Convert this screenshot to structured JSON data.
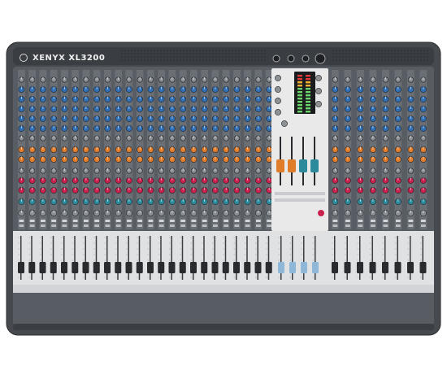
{
  "product": {
    "brand": "XENYX",
    "model": "XL3200"
  },
  "colors": {
    "body": "#4b4e53",
    "body_dark": "#303236",
    "panel": "#5c6067",
    "strip": "#6a6e75",
    "knob_blue": "#2f6fb6",
    "knob_gray": "#8c9196",
    "knob_orange": "#e07c2a",
    "knob_red": "#c9214e",
    "knob_teal": "#2b8a9b",
    "fader_zone": "#dfe1e3",
    "fader_cap": "#2a2b2e",
    "master_panel": "#e9e9ea"
  },
  "layout_info": {
    "input_channels": 32,
    "master_faders": 4
  }
}
